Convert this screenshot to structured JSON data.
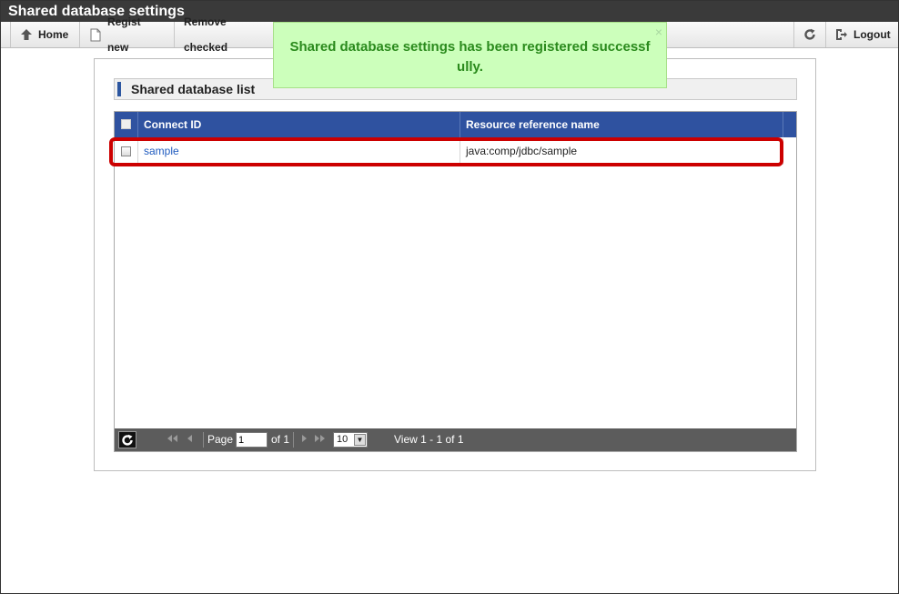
{
  "window": {
    "title": "Shared database settings"
  },
  "toolbar": {
    "home_label": "Home",
    "regist_label": "Regist new",
    "remove_label": "Remove checked",
    "logout_label": "Logout",
    "icons": {
      "home": "home-up-arrow-icon",
      "regist": "new-document-icon",
      "refresh": "refresh-icon",
      "logout": "logout-icon"
    }
  },
  "toast": {
    "message": "Shared database settings has been registered successfully.",
    "close": "×"
  },
  "panel": {
    "title": "Shared database list"
  },
  "table": {
    "columns": [
      "Connect ID",
      "Resource reference name"
    ],
    "rows": [
      {
        "connect_id": "sample",
        "resource_reference_name": "java:comp/jdbc/sample"
      }
    ]
  },
  "pager": {
    "page_label": "Page",
    "page_value": "1",
    "of_label": "of 1",
    "page_size": "10",
    "view_text": "View 1 - 1 of 1"
  },
  "colors": {
    "header_blue": "#2f52a0",
    "toast_bg": "#ccffbb",
    "toast_text": "#2a8a1c",
    "highlight": "#cc0000"
  }
}
